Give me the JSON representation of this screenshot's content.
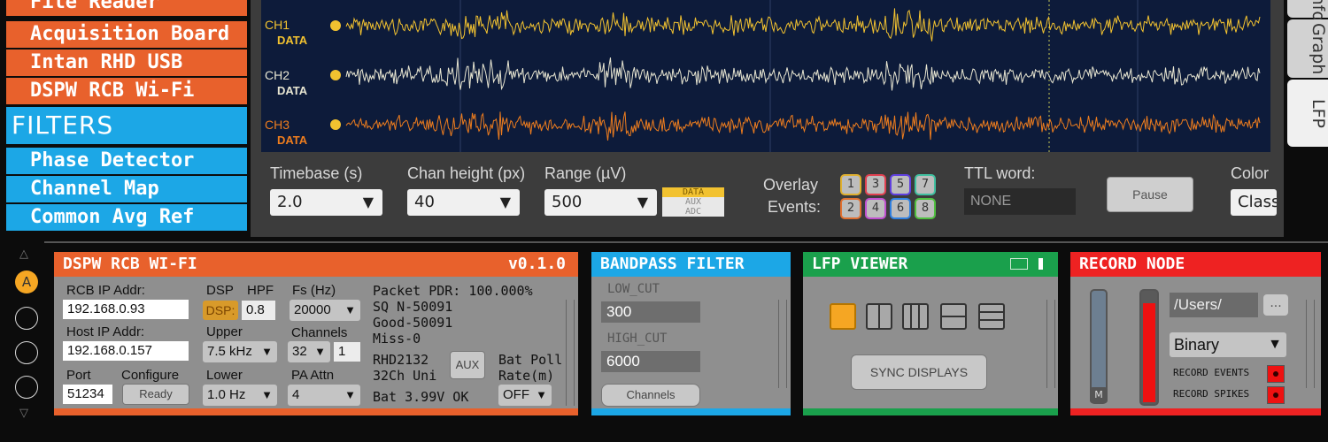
{
  "processor_list": {
    "sources": [
      "File Reader",
      "Acquisition Board",
      "Intan RHD USB",
      "DSPW RCB Wi-Fi"
    ],
    "filters_header": "FILTERS",
    "filters": [
      "Phase Detector",
      "Channel Map",
      "Common Avg Ref"
    ]
  },
  "lfp": {
    "channels": [
      {
        "name": "CH1",
        "tag": "DATA",
        "color": "#f2c230"
      },
      {
        "name": "CH2",
        "tag": "DATA",
        "color": "#e8e6d2"
      },
      {
        "name": "CH3",
        "tag": "DATA",
        "color": "#ee7d1e"
      }
    ],
    "options": {
      "timebase_label": "Timebase (s)",
      "timebase_value": "2.0",
      "chan_height_label": "Chan height (px)",
      "chan_height_value": "40",
      "range_label": "Range (µV)",
      "range_value": "500",
      "type_tags": [
        "DATA",
        "AUX",
        "ADC"
      ],
      "overlay_label": "Overlay",
      "events_label": "Events:",
      "event_buttons": [
        "1",
        "3",
        "5",
        "7",
        "2",
        "4",
        "6",
        "8"
      ],
      "ttl_label": "TTL word:",
      "ttl_value": "NONE",
      "pause_label": "Pause",
      "color_label": "Color",
      "color_value": "Class"
    },
    "side_tabs": [
      "Info",
      "Graph",
      "LFP"
    ]
  },
  "editors": {
    "dspw": {
      "title": "DSPW RCB WI-FI",
      "version": "v0.1.0",
      "color": "#e8612c",
      "rcb_ip_label": "RCB IP Addr:",
      "rcb_ip_value": "192.168.0.93",
      "host_ip_label": "Host IP Addr:",
      "host_ip_value": "192.168.0.157",
      "port_label": "Port",
      "port_value": "51234",
      "configure_label": "Configure",
      "ready_label": "Ready",
      "dsp_label": "DSP",
      "hpf_label": "HPF",
      "dsp_btn": "DSP:",
      "hpf_value": "0.8",
      "upper_label": "Upper",
      "upper_value": "7.5 kHz",
      "lower_label": "Lower",
      "lower_value": "1.0 Hz",
      "fs_label": "Fs (Hz)",
      "fs_value": "20000",
      "channels_label": "Channels",
      "channels_value": "32",
      "channels_step": "1",
      "pa_label": "PA Attn",
      "pa_value": "4",
      "status": [
        "Packet PDR: 100.000%",
        "SQ N-50091",
        "Good-50091",
        "Miss-0"
      ],
      "chip": [
        "RHD2132",
        "32Ch Uni"
      ],
      "aux_btn": "AUX",
      "bat_poll_label": [
        "Bat Poll",
        "Rate(m)"
      ],
      "bat_poll_value": "OFF",
      "battery": "Bat 3.99V OK"
    },
    "bandpass": {
      "title": "BANDPASS FILTER",
      "color": "#1ca7e6",
      "low_label": "LOW_CUT",
      "low_value": "300",
      "high_label": "HIGH_CUT",
      "high_value": "6000",
      "channels_btn": "Channels"
    },
    "lfpviewer": {
      "title": "LFP VIEWER",
      "color": "#1aa04c",
      "sync_btn": "SYNC DISPLAYS"
    },
    "record": {
      "title": "RECORD NODE",
      "color": "#ee2222",
      "path": "/Users/",
      "browse": "...",
      "format": "Binary",
      "record_events": "RECORD EVENTS",
      "record_spikes": "RECORD SPIKES",
      "m_label": "M"
    }
  },
  "signal_chain": {
    "active_label": "A"
  }
}
